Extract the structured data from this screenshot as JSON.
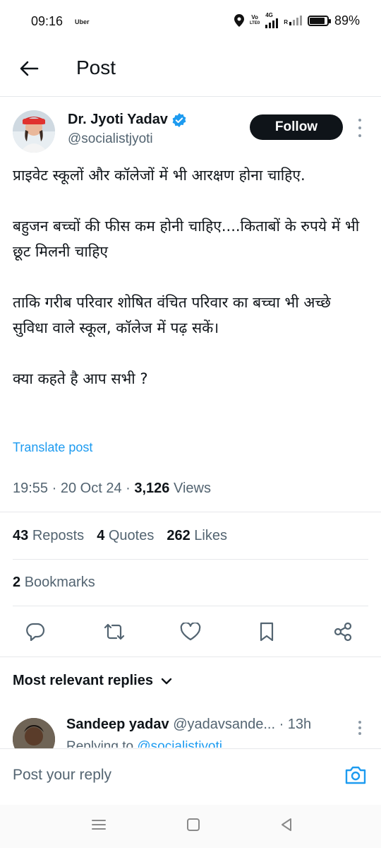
{
  "status_bar": {
    "time": "09:16",
    "notification": "Uber",
    "volte_top": "Vo",
    "volte_bottom": "LTE0",
    "network": "4G",
    "roaming": "R",
    "battery": "89%",
    "battery_level": 0.89
  },
  "header": {
    "title": "Post"
  },
  "author": {
    "name": "Dr. Jyoti Yadav",
    "handle": "@socialistjyoti",
    "follow_label": "Follow"
  },
  "post": {
    "paragraphs": [
      "प्राइवेट स्कूलों और कॉलेजों में भी आरक्षण होना चाहिए.",
      "बहुजन बच्चों की फीस कम होनी चाहिए....किताबों के रुपये में भी छूट मिलनी चाहिए",
      "ताकि गरीब परिवार शोषित वंचित  परिवार का बच्चा भी अच्छे सुविधा वाले स्कूल, कॉलेज में पढ़ सकें।",
      "क्या कहते है आप सभी ?"
    ],
    "translate_label": "Translate post",
    "time": "19:55",
    "date": "20 Oct 24",
    "separator": "·",
    "views_count": "3,126",
    "views_label": "Views"
  },
  "stats": {
    "reposts_count": "43",
    "reposts_label": "Reposts",
    "quotes_count": "4",
    "quotes_label": "Quotes",
    "likes_count": "262",
    "likes_label": "Likes",
    "bookmarks_count": "2",
    "bookmarks_label": "Bookmarks"
  },
  "actions": [
    "reply-icon",
    "repost-icon",
    "like-icon",
    "bookmark-icon",
    "share-icon"
  ],
  "replies": {
    "sort_label": "Most relevant replies",
    "first": {
      "name": "Sandeep yadav",
      "handle": "@yadavsande...",
      "time": "· 13h",
      "replying_prefix": "Replying to",
      "replying_handle": "@socialistjyoti"
    }
  },
  "composer": {
    "placeholder": "Post your reply"
  },
  "colors": {
    "accent": "#1d9bf0",
    "text": "#0f1419",
    "secondary": "#536471",
    "verified": "#1d9bf0"
  }
}
